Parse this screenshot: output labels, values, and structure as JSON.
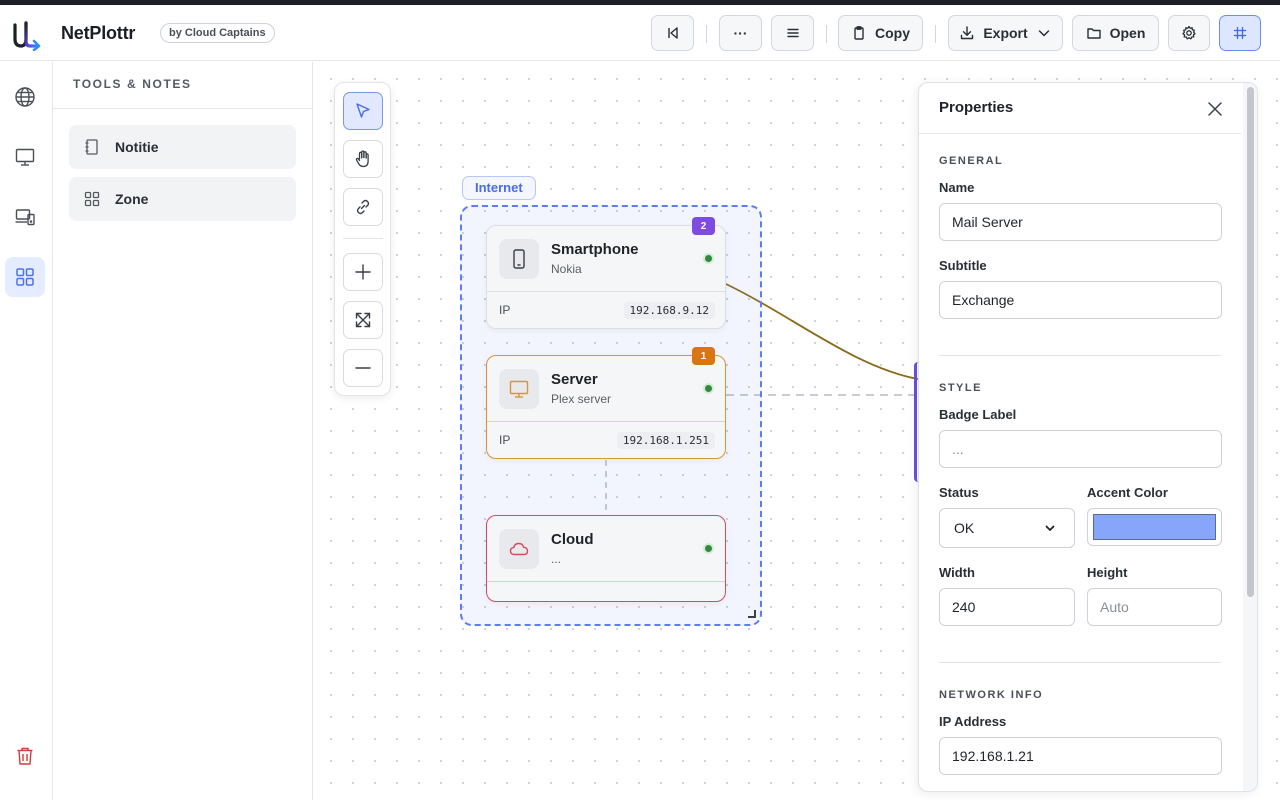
{
  "header": {
    "brand": "NetPlottr",
    "byline": "by Cloud Captains",
    "buttons": {
      "dots_label": "···",
      "copy_label": "Copy",
      "export_label": "Export",
      "open_label": "Open"
    }
  },
  "tools_panel": {
    "title": "TOOLS & NOTES",
    "items": [
      {
        "label": "Notitie",
        "icon": "notebook-icon"
      },
      {
        "label": "Zone",
        "icon": "grid-icon"
      }
    ]
  },
  "canvas": {
    "zone": {
      "label": "Internet",
      "accent": "#5d7ef0"
    },
    "nodes": [
      {
        "title": "Smartphone",
        "subtitle": "Nokia",
        "ip_label": "IP",
        "ip": "192.168.9.12",
        "badge": "2",
        "badge_color": "#7e4be0",
        "icon": "smartphone-icon"
      },
      {
        "title": "Server",
        "subtitle": "Plex server",
        "ip_label": "IP",
        "ip": "192.168.1.251",
        "badge": "1",
        "badge_color": "#d9760f",
        "icon": "monitor-icon",
        "accent": "#d9953a"
      },
      {
        "title": "Cloud",
        "subtitle": "...",
        "icon": "cloud-icon",
        "accent": "#d94a5a"
      }
    ],
    "edge_color": "#8a6a1a"
  },
  "properties": {
    "title": "Properties",
    "general": {
      "heading": "GENERAL",
      "name_label": "Name",
      "name_value": "Mail Server",
      "subtitle_label": "Subtitle",
      "subtitle_value": "Exchange"
    },
    "style": {
      "heading": "STYLE",
      "badge_label": "Badge Label",
      "badge_placeholder": "...",
      "status_label": "Status",
      "status_value": "OK",
      "accent_label": "Accent Color",
      "accent_value": "#87a5fb",
      "width_label": "Width",
      "width_value": "240",
      "height_label": "Height",
      "height_placeholder": "Auto"
    },
    "network": {
      "heading": "NETWORK INFO",
      "ip_label": "IP Address",
      "ip_value": "192.168.1.21"
    }
  }
}
